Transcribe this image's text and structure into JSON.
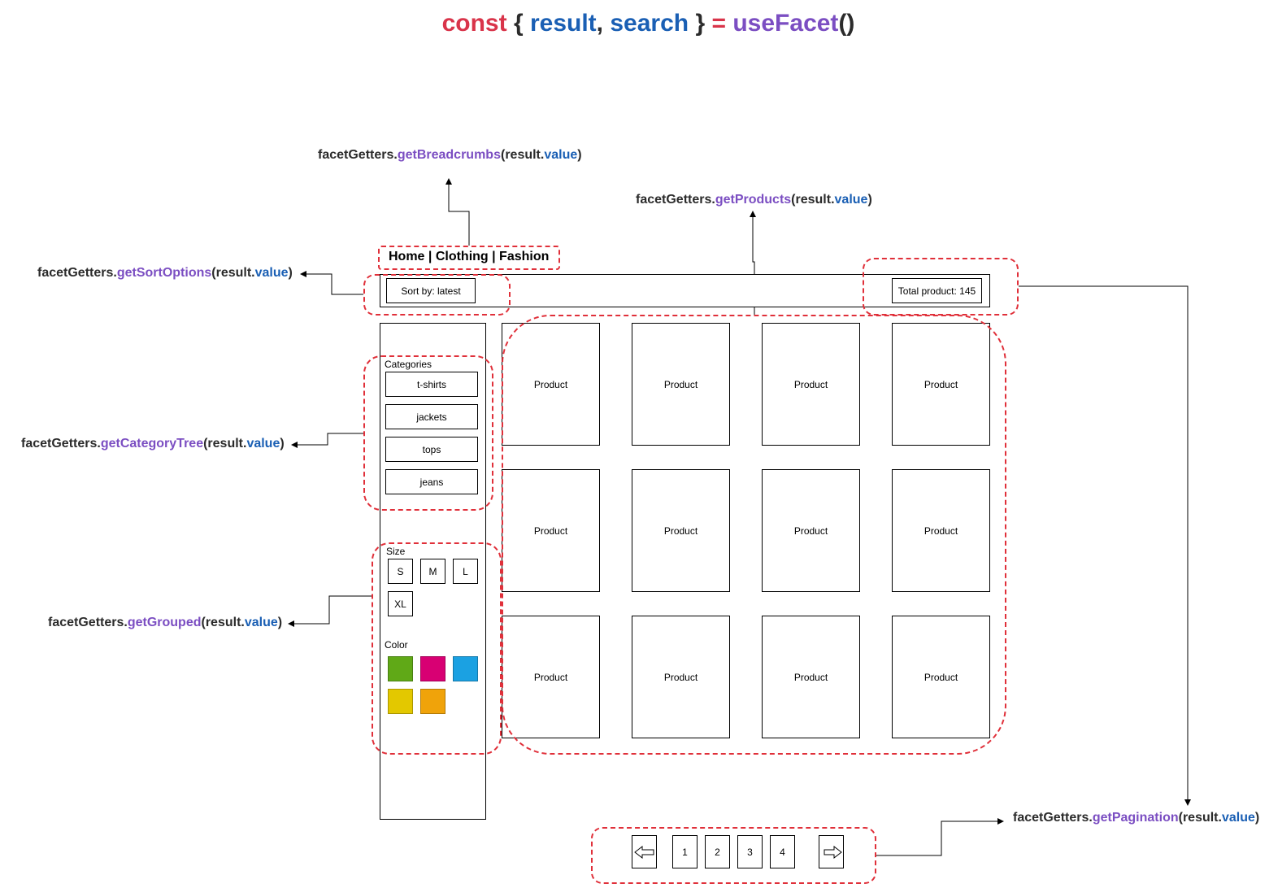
{
  "title": {
    "const_kw": "const",
    "open_brace": "{",
    "result": "result",
    "comma": ",",
    "search": "search",
    "close_brace": "}",
    "equals": "=",
    "fn": "useFacet",
    "parens": "()"
  },
  "getters": {
    "prefix": "facetGetters.",
    "arg_open": "(result.",
    "arg_value": "value",
    "arg_close": ")",
    "breadcrumbs": "getBreadcrumbs",
    "products": "getProducts",
    "sort_options": "getSortOptions",
    "category_tree": "getCategoryTree",
    "grouped": "getGrouped",
    "pagination": "getPagination"
  },
  "breadcrumb": "Home | Clothing | Fashion",
  "toolbar": {
    "sort_label": "Sort by: latest",
    "total_label": "Total product: 145"
  },
  "sidebar": {
    "categories_heading": "Categories",
    "categories": [
      "t-shirts",
      "jackets",
      "tops",
      "jeans"
    ],
    "size_heading": "Size",
    "sizes": [
      "S",
      "M",
      "L",
      "XL"
    ],
    "color_heading": "Color",
    "colors": [
      {
        "name": "green",
        "hex": "#60a917"
      },
      {
        "name": "magenta",
        "hex": "#d80073"
      },
      {
        "name": "blue",
        "hex": "#1ba1e2"
      },
      {
        "name": "yellow",
        "hex": "#e3c800"
      },
      {
        "name": "orange",
        "hex": "#f0a30a"
      }
    ]
  },
  "products": {
    "label": "Product",
    "count": 12
  },
  "pagination": {
    "pages": [
      "1",
      "2",
      "3",
      "4"
    ],
    "prev_icon": "arrow-left-icon",
    "next_icon": "arrow-right-icon"
  },
  "colors": {
    "annotation_dash": "#e0303a",
    "keyword_red": "#d9344a",
    "identifier_blue": "#1a5fb4",
    "function_purple": "#7b4ec2"
  }
}
